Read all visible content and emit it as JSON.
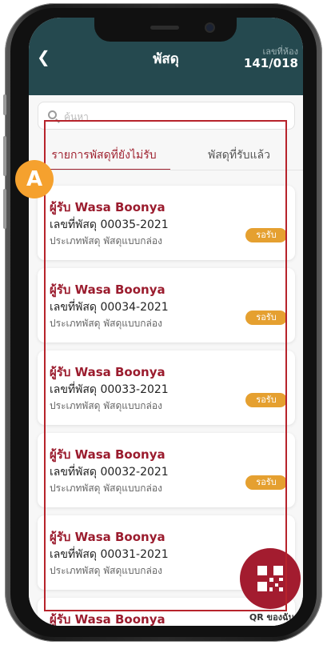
{
  "header": {
    "title": "พัสดุ",
    "room_label": "เลขที่ห้อง",
    "room_number": "141/018"
  },
  "search": {
    "placeholder": "ค้นหา"
  },
  "tabs": [
    {
      "label": "รายการพัสดุที่ยังไม่รับ",
      "active": true
    },
    {
      "label": "พัสดุที่รับแล้ว",
      "active": false
    }
  ],
  "parcels": [
    {
      "receiver": "ผู้รับ Wasa Boonya",
      "number": "เลขที่พัสดุ 00035-2021",
      "type": "ประเภทพัสดุ พัสดุแบบกล่อง",
      "status": "รอรับ"
    },
    {
      "receiver": "ผู้รับ Wasa Boonya",
      "number": "เลขที่พัสดุ 00034-2021",
      "type": "ประเภทพัสดุ พัสดุแบบกล่อง",
      "status": "รอรับ"
    },
    {
      "receiver": "ผู้รับ Wasa Boonya",
      "number": "เลขที่พัสดุ 00033-2021",
      "type": "ประเภทพัสดุ พัสดุแบบกล่อง",
      "status": "รอรับ"
    },
    {
      "receiver": "ผู้รับ Wasa Boonya",
      "number": "เลขที่พัสดุ 00032-2021",
      "type": "ประเภทพัสดุ พัสดุแบบกล่อง",
      "status": "รอรับ"
    },
    {
      "receiver": "ผู้รับ Wasa Boonya",
      "number": "เลขที่พัสดุ 00031-2021",
      "type": "ประเภทพัสดุ พัสดุแบบกล่อง",
      "status": ""
    },
    {
      "receiver": "ผู้รับ Wasa Boonya",
      "number": "",
      "type": "",
      "status": ""
    }
  ],
  "qr_button": {
    "label": "QR ของฉัน"
  },
  "annotation": {
    "marker": "A"
  },
  "colors": {
    "header_bg": "#25494f",
    "accent": "#a02432",
    "badge": "#e5a030"
  },
  "icons": [
    "back-chevron-icon",
    "search-icon",
    "qr-code-icon"
  ]
}
